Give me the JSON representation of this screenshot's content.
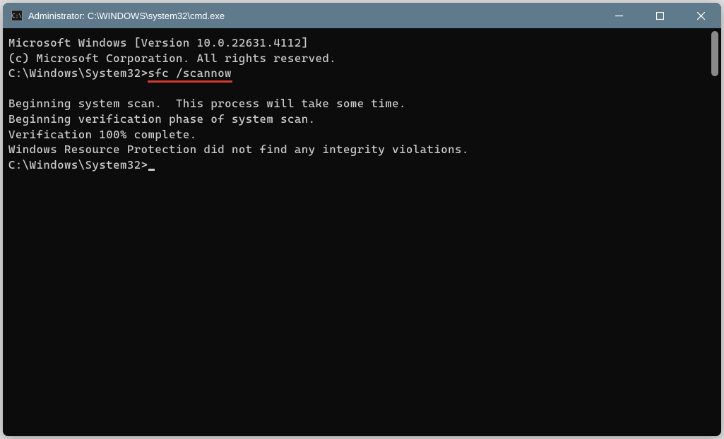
{
  "titlebar": {
    "icon_label": "C:\\",
    "title": "Administrator: C:\\WINDOWS\\system32\\cmd.exe"
  },
  "window_controls": {
    "minimize": "minimize",
    "maximize": "maximize",
    "close": "close"
  },
  "terminal": {
    "lines": {
      "l0": "Microsoft Windows [Version 10.0.22631.4112]",
      "l1": "(c) Microsoft Corporation. All rights reserved.",
      "l2": "",
      "l3_prompt": "C:\\Windows\\System32>",
      "l3_command": "sfc /scannow",
      "l4": "",
      "l5": "Beginning system scan.  This process will take some time.",
      "l6": "",
      "l7": "Beginning verification phase of system scan.",
      "l8": "Verification 100% complete.",
      "l9": "",
      "l10": "Windows Resource Protection did not find any integrity violations.",
      "l11": "",
      "l12_prompt": "C:\\Windows\\System32>"
    }
  },
  "annotation": {
    "underline_color": "#d43a2f"
  }
}
